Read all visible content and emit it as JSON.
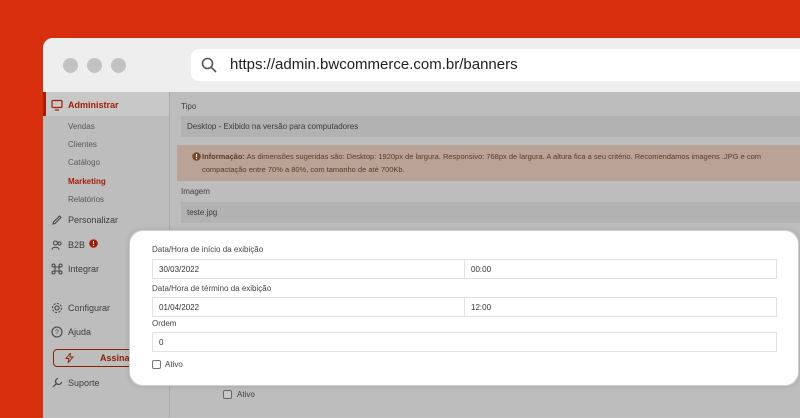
{
  "browser": {
    "url": "https://admin.bwcommerce.com.br/banners"
  },
  "sidebar": {
    "administrar": "Administrar",
    "sub_items": [
      "Vendas",
      "Clientes",
      "Catálogo",
      "Marketing",
      "Relatórios"
    ],
    "personalizar": "Personalizar",
    "b2b": "B2B",
    "integrar": "Integrar",
    "configurar": "Configurar",
    "ajuda": "Ajuda",
    "assinar": "Assinar",
    "suporte": "Suporte"
  },
  "form": {
    "tipo_label": "Tipo",
    "tipo_value": "Desktop - Exibido na versão para computadores",
    "info_title": "Informação:",
    "info_text": "As dimensões sugeridas são: Desktop: 1920px de largura. Responsivo: 768px de largura. A altura fica a seu critério. Recomendamos imagens .JPG e com compactação entre 70% a 80%, com tamanho de até 700Kb.",
    "imagem_label": "Imagem",
    "imagem_value": "teste.jpg",
    "ativo_bottom": "Ativo"
  },
  "card": {
    "inicio_label": "Data/Hora de início da exibição",
    "inicio_date": "30/03/2022",
    "inicio_time": "00:00",
    "termino_label": "Data/Hora de término da exibição",
    "termino_date": "01/04/2022",
    "termino_time": "12:00",
    "ordem_label": "Ordem",
    "ordem_value": "0",
    "ativo_label": "Ativo"
  },
  "colors": {
    "background": "#d8300f",
    "accent": "#a31e05"
  }
}
